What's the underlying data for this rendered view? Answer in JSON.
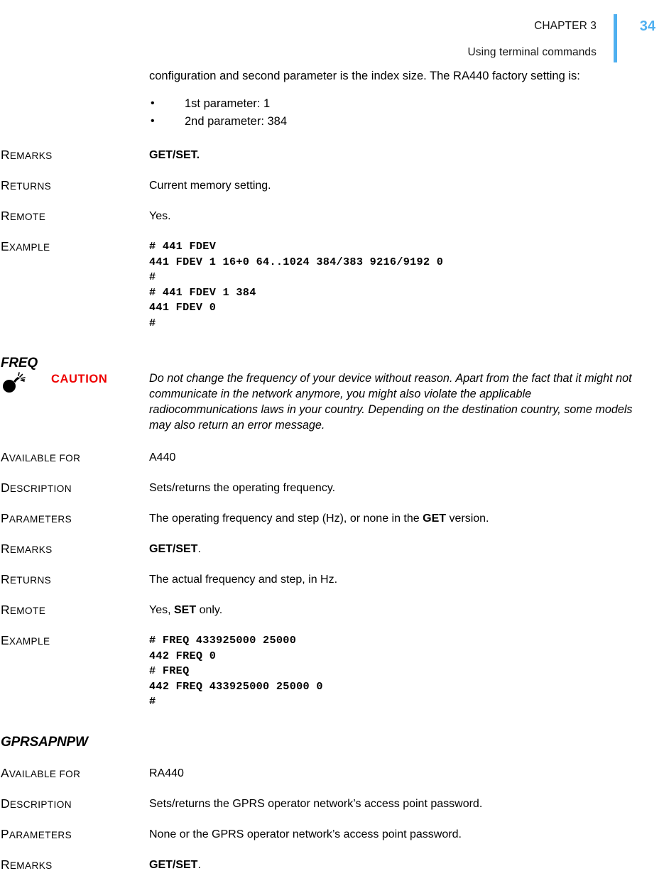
{
  "header": {
    "chapter": "CHAPTER 3",
    "subtitle": "Using terminal commands",
    "page_number": "34",
    "rule_color": "#4FB0F0",
    "page_number_color": "#4FB0F0"
  },
  "intro": {
    "paragraph": "configuration and second parameter is the index size. The RA440 factory setting is:",
    "bullets": [
      "1st parameter: 1",
      "2nd parameter: 384"
    ],
    "bullet_glyph": "•"
  },
  "fdev_section": {
    "rows": [
      {
        "label_first": "R",
        "label_rest": "EMARKS",
        "value": "GET/SET.",
        "bold": true
      },
      {
        "label_first": "R",
        "label_rest": "ETURNS",
        "value": "Current memory setting.",
        "bold": false
      },
      {
        "label_first": "R",
        "label_rest": "EMOTE",
        "value": "Yes.",
        "bold": false
      }
    ],
    "example_label_first": "E",
    "example_label_rest": "XAMPLE",
    "example_code": "# 441 FDEV\n441 FDEV 1 16+0 64..1024 384/383 9216/9192 0\n#\n# 441 FDEV 1 384\n441 FDEV 0\n#"
  },
  "freq_section": {
    "heading": "FREQ",
    "caution": {
      "icon": "bomb-icon",
      "word": "CAUTION",
      "color": "#EE0000",
      "text": "Do not change the frequency of your device without reason. Apart from the fact that it might not communicate in the network anymore, you might also violate the applicable radiocommunications laws in your country. Depending on the destination country, some models may also return an error message."
    },
    "rows": [
      {
        "label_first": "A",
        "label_rest": "VAILABLE FOR",
        "value": "A440"
      },
      {
        "label_first": "D",
        "label_rest": "ESCRIPTION",
        "value": "Sets/returns the operating frequency."
      },
      {
        "label_first": "P",
        "label_rest": "ARAMETERS",
        "value_pre": "The operating frequency and step (Hz), or none in the ",
        "value_bold": "GET",
        "value_post": " version."
      },
      {
        "label_first": "R",
        "label_rest": "EMARKS",
        "value_bold": "GET/SET",
        "value_post": "."
      },
      {
        "label_first": "R",
        "label_rest": "ETURNS",
        "value": "The actual frequency and step, in Hz."
      },
      {
        "label_first": "R",
        "label_rest": "EMOTE",
        "value_pre": "Yes, ",
        "value_bold": "SET",
        "value_post": " only."
      }
    ],
    "example_label_first": "E",
    "example_label_rest": "XAMPLE",
    "example_code": "# FREQ 433925000 25000\n442 FREQ 0\n# FREQ\n442 FREQ 433925000 25000 0\n#"
  },
  "gprsapnpw_section": {
    "heading": "GPRSAPNPW",
    "rows": [
      {
        "label_first": "A",
        "label_rest": "VAILABLE FOR",
        "value": "RA440"
      },
      {
        "label_first": "D",
        "label_rest": "ESCRIPTION",
        "value": "Sets/returns the GPRS operator network’s access point password."
      },
      {
        "label_first": "P",
        "label_rest": "ARAMETERS",
        "value": "None or the GPRS operator network’s access point password."
      },
      {
        "label_first": "R",
        "label_rest": "EMARKS",
        "value_bold": "GET/SET",
        "value_post": "."
      }
    ]
  }
}
